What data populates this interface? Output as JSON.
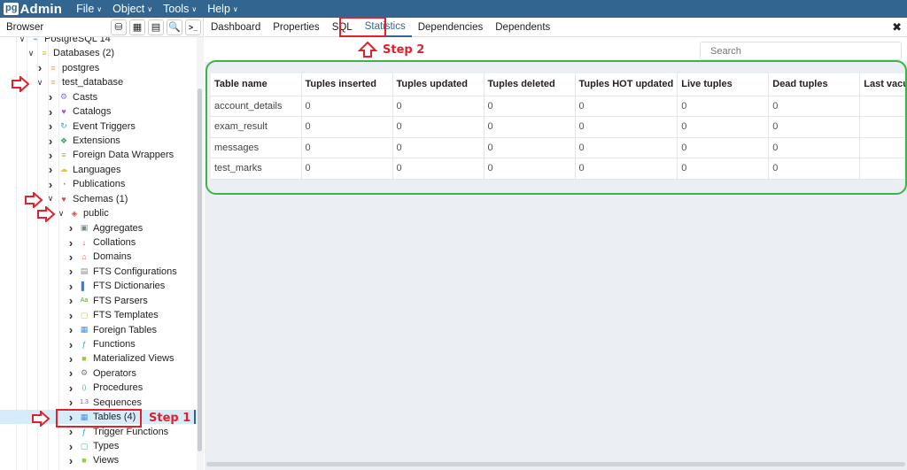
{
  "app": {
    "logo_pg": "pg",
    "logo_admin": "Admin",
    "menu": [
      {
        "label": "File"
      },
      {
        "label": "Object"
      },
      {
        "label": "Tools"
      },
      {
        "label": "Help"
      }
    ],
    "brand_color": "#326690"
  },
  "browser": {
    "title": "Browser",
    "toolbar": [
      {
        "icon": "database-icon",
        "glyph": "⛁"
      },
      {
        "icon": "table-icon",
        "glyph": "▦"
      },
      {
        "icon": "filtered-rows-icon",
        "glyph": "▤"
      },
      {
        "icon": "search-icon",
        "glyph": "🔍"
      },
      {
        "icon": "terminal-icon",
        "glyph": ">_"
      }
    ],
    "tree": [
      {
        "label": "PostgreSQL 14",
        "level": 0,
        "expanded": true,
        "icon": "server-icon",
        "color": "#5b8ec2",
        "glyph": "⌁"
      },
      {
        "label": "Databases (2)",
        "level": 1,
        "expanded": true,
        "icon": "databases-icon",
        "color": "#d6b43a",
        "glyph": "≡"
      },
      {
        "label": "postgres",
        "level": 2,
        "expanded": false,
        "icon": "database-icon",
        "color": "#d6b43a",
        "glyph": "≡"
      },
      {
        "label": "test_database",
        "level": 2,
        "expanded": true,
        "icon": "database-icon",
        "color": "#d6b43a",
        "glyph": "≡"
      },
      {
        "label": "Casts",
        "level": 3,
        "expanded": false,
        "icon": "casts-icon",
        "color": "#8a6fd6",
        "glyph": "⚙"
      },
      {
        "label": "Catalogs",
        "level": 3,
        "expanded": false,
        "icon": "catalogs-icon",
        "color": "#a35ad0",
        "glyph": "♥"
      },
      {
        "label": "Event Triggers",
        "level": 3,
        "expanded": false,
        "icon": "event-triggers-icon",
        "color": "#3aa6c4",
        "glyph": "↻"
      },
      {
        "label": "Extensions",
        "level": 3,
        "expanded": false,
        "icon": "extensions-icon",
        "color": "#3b9e58",
        "glyph": "❖"
      },
      {
        "label": "Foreign Data Wrappers",
        "level": 3,
        "expanded": false,
        "icon": "foreign-data-wrappers-icon",
        "color": "#c7a23c",
        "glyph": "≡"
      },
      {
        "label": "Languages",
        "level": 3,
        "expanded": false,
        "icon": "languages-icon",
        "color": "#e8c830",
        "glyph": "☁"
      },
      {
        "label": "Publications",
        "level": 3,
        "expanded": false,
        "icon": "publications-icon",
        "color": "#7b95d0",
        "glyph": "◔"
      },
      {
        "label": "Schemas (1)",
        "level": 3,
        "expanded": true,
        "icon": "schemas-icon",
        "color": "#d2505a",
        "glyph": "♥"
      },
      {
        "label": "public",
        "level": 4,
        "expanded": true,
        "icon": "schema-icon",
        "color": "#e04444",
        "glyph": "◈"
      },
      {
        "label": "Aggregates",
        "level": 5,
        "expanded": false,
        "icon": "aggregates-icon",
        "color": "#7a8a8a",
        "glyph": "▣"
      },
      {
        "label": "Collations",
        "level": 5,
        "expanded": false,
        "icon": "collations-icon",
        "color": "#e04444",
        "glyph": "↓"
      },
      {
        "label": "Domains",
        "level": 5,
        "expanded": false,
        "icon": "domains-icon",
        "color": "#c05a3c",
        "glyph": "⌂"
      },
      {
        "label": "FTS Configurations",
        "level": 5,
        "expanded": false,
        "icon": "fts-configurations-icon",
        "color": "#8a8a8a",
        "glyph": "▤"
      },
      {
        "label": "FTS Dictionaries",
        "level": 5,
        "expanded": false,
        "icon": "fts-dictionaries-icon",
        "color": "#4a78c2",
        "glyph": "▌"
      },
      {
        "label": "FTS Parsers",
        "level": 5,
        "expanded": false,
        "icon": "fts-parsers-icon",
        "color": "#5aa02c",
        "glyph": "Aa"
      },
      {
        "label": "FTS Templates",
        "level": 5,
        "expanded": false,
        "icon": "fts-templates-icon",
        "color": "#e8c830",
        "glyph": "▢"
      },
      {
        "label": "Foreign Tables",
        "level": 5,
        "expanded": false,
        "icon": "foreign-tables-icon",
        "color": "#4a90d9",
        "glyph": "▦"
      },
      {
        "label": "Functions",
        "level": 5,
        "expanded": false,
        "icon": "functions-icon",
        "color": "#3aa6c4",
        "glyph": "ƒ"
      },
      {
        "label": "Materialized Views",
        "level": 5,
        "expanded": false,
        "icon": "materialized-views-icon",
        "color": "#8fd13c",
        "glyph": "■"
      },
      {
        "label": "Operators",
        "level": 5,
        "expanded": false,
        "icon": "operators-icon",
        "color": "#777",
        "glyph": "⚙"
      },
      {
        "label": "Procedures",
        "level": 5,
        "expanded": false,
        "icon": "procedures-icon",
        "color": "#3aa6c4",
        "glyph": "()"
      },
      {
        "label": "Sequences",
        "level": 5,
        "expanded": false,
        "icon": "sequences-icon",
        "color": "#6a5ad0",
        "glyph": "1.3"
      },
      {
        "label": "Tables (4)",
        "level": 5,
        "expanded": false,
        "selected": true,
        "icon": "tables-icon",
        "color": "#4a90d9",
        "glyph": "▦"
      },
      {
        "label": "Trigger Functions",
        "level": 5,
        "expanded": false,
        "icon": "trigger-functions-icon",
        "color": "#3aa6c4",
        "glyph": "ƒ"
      },
      {
        "label": "Types",
        "level": 5,
        "expanded": false,
        "icon": "types-icon",
        "color": "#4ac4a0",
        "glyph": "▢"
      },
      {
        "label": "Views",
        "level": 5,
        "expanded": false,
        "icon": "views-icon",
        "color": "#8fd13c",
        "glyph": "■"
      }
    ]
  },
  "tabs": [
    {
      "label": "Dashboard",
      "active": false
    },
    {
      "label": "Properties",
      "active": false
    },
    {
      "label": "SQL",
      "active": false
    },
    {
      "label": "Statistics",
      "active": true
    },
    {
      "label": "Dependencies",
      "active": false
    },
    {
      "label": "Dependents",
      "active": false
    }
  ],
  "close_label": "✖",
  "search": {
    "placeholder": "Search",
    "value": ""
  },
  "statistics": {
    "columns": [
      "Table name",
      "Tuples inserted",
      "Tuples updated",
      "Tuples deleted",
      "Tuples HOT updated",
      "Live tuples",
      "Dead tuples",
      "Last vacuum"
    ],
    "rows": [
      [
        "account_details",
        "0",
        "0",
        "0",
        "0",
        "0",
        "0",
        ""
      ],
      [
        "exam_result",
        "0",
        "0",
        "0",
        "0",
        "0",
        "0",
        ""
      ],
      [
        "messages",
        "0",
        "0",
        "0",
        "0",
        "0",
        "0",
        ""
      ],
      [
        "test_marks",
        "0",
        "0",
        "0",
        "0",
        "0",
        "0",
        ""
      ]
    ]
  },
  "annotations": {
    "step1": "Step 1",
    "step2": "Step 2",
    "highlight_color": "#e2212b",
    "table_outline_color": "#3cb44b"
  }
}
